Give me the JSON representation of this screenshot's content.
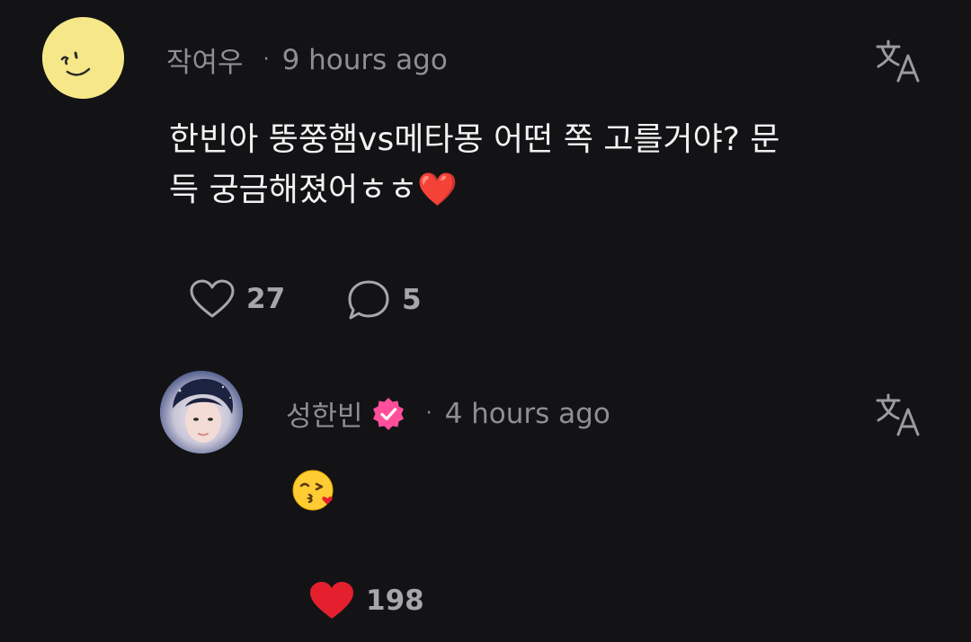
{
  "comment": {
    "username": "작여우",
    "separator": "·",
    "timestamp": "9 hours ago",
    "text": "한빈아 뚱쭝햄vs메타몽 어떤 쪽 고를거야? 문득 궁금해졌어ㅎㅎ",
    "trailing_emoji": "❤️",
    "like_count": "27",
    "reply_count": "5",
    "avatar_icon": "smiley-face-icon",
    "translate_icon": "translate-icon"
  },
  "reply": {
    "username": "성한빈",
    "verified_icon": "verified-badge-icon",
    "separator": "·",
    "timestamp": "4 hours ago",
    "emoji": "kissing-face-with-heart-emoji",
    "like_count": "198",
    "liked": true,
    "translate_icon": "translate-icon"
  },
  "colors": {
    "background": "#131316",
    "text_primary": "#f2f2f2",
    "text_secondary": "#8e8e93",
    "like_active": "#e4202e",
    "verified_badge": "#ff4f9a",
    "avatar_yellow": "#f6e888"
  }
}
